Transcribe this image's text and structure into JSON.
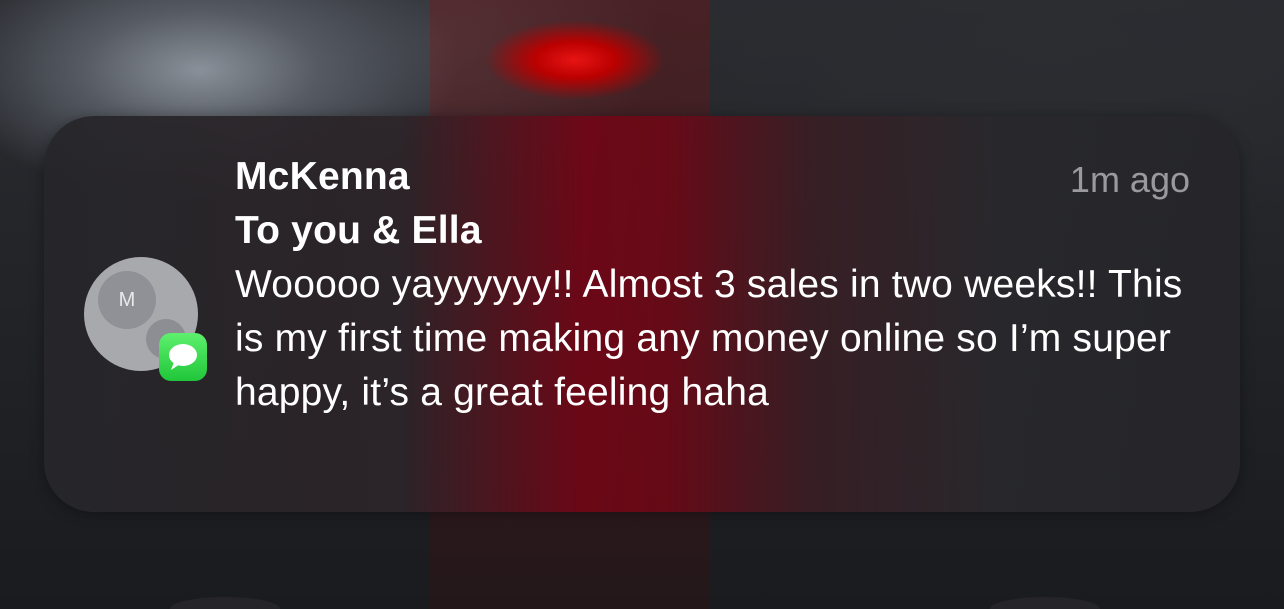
{
  "notification": {
    "sender": "McKenna",
    "recipients": "To you & Ella",
    "timestamp": "1m ago",
    "message": "Wooooo yayyyyyy!! Almost 3 sales in two weeks!! This is my first time making any money online so I’m super happy, it’s a great feeling haha",
    "avatar_initial": "M",
    "app_icon": "messages-icon",
    "app_icon_color": "#34c759"
  }
}
